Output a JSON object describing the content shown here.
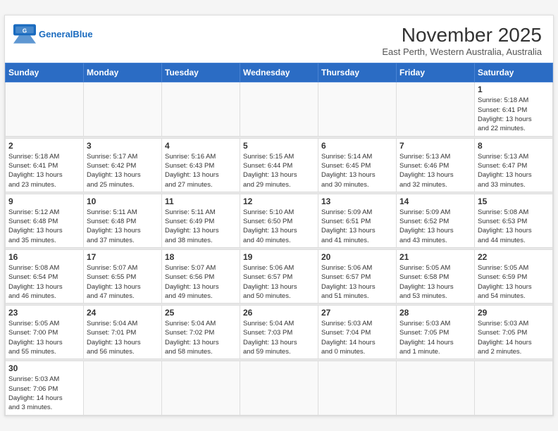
{
  "header": {
    "logo_general": "General",
    "logo_blue": "Blue",
    "month_title": "November 2025",
    "subtitle": "East Perth, Western Australia, Australia"
  },
  "days_of_week": [
    "Sunday",
    "Monday",
    "Tuesday",
    "Wednesday",
    "Thursday",
    "Friday",
    "Saturday"
  ],
  "weeks": [
    [
      {
        "day": "",
        "info": ""
      },
      {
        "day": "",
        "info": ""
      },
      {
        "day": "",
        "info": ""
      },
      {
        "day": "",
        "info": ""
      },
      {
        "day": "",
        "info": ""
      },
      {
        "day": "",
        "info": ""
      },
      {
        "day": "1",
        "info": "Sunrise: 5:18 AM\nSunset: 6:41 PM\nDaylight: 13 hours\nand 22 minutes."
      }
    ],
    [
      {
        "day": "2",
        "info": "Sunrise: 5:18 AM\nSunset: 6:41 PM\nDaylight: 13 hours\nand 23 minutes."
      },
      {
        "day": "3",
        "info": "Sunrise: 5:17 AM\nSunset: 6:42 PM\nDaylight: 13 hours\nand 25 minutes."
      },
      {
        "day": "4",
        "info": "Sunrise: 5:16 AM\nSunset: 6:43 PM\nDaylight: 13 hours\nand 27 minutes."
      },
      {
        "day": "5",
        "info": "Sunrise: 5:15 AM\nSunset: 6:44 PM\nDaylight: 13 hours\nand 29 minutes."
      },
      {
        "day": "6",
        "info": "Sunrise: 5:14 AM\nSunset: 6:45 PM\nDaylight: 13 hours\nand 30 minutes."
      },
      {
        "day": "7",
        "info": "Sunrise: 5:13 AM\nSunset: 6:46 PM\nDaylight: 13 hours\nand 32 minutes."
      },
      {
        "day": "8",
        "info": "Sunrise: 5:13 AM\nSunset: 6:47 PM\nDaylight: 13 hours\nand 33 minutes."
      }
    ],
    [
      {
        "day": "9",
        "info": "Sunrise: 5:12 AM\nSunset: 6:48 PM\nDaylight: 13 hours\nand 35 minutes."
      },
      {
        "day": "10",
        "info": "Sunrise: 5:11 AM\nSunset: 6:48 PM\nDaylight: 13 hours\nand 37 minutes."
      },
      {
        "day": "11",
        "info": "Sunrise: 5:11 AM\nSunset: 6:49 PM\nDaylight: 13 hours\nand 38 minutes."
      },
      {
        "day": "12",
        "info": "Sunrise: 5:10 AM\nSunset: 6:50 PM\nDaylight: 13 hours\nand 40 minutes."
      },
      {
        "day": "13",
        "info": "Sunrise: 5:09 AM\nSunset: 6:51 PM\nDaylight: 13 hours\nand 41 minutes."
      },
      {
        "day": "14",
        "info": "Sunrise: 5:09 AM\nSunset: 6:52 PM\nDaylight: 13 hours\nand 43 minutes."
      },
      {
        "day": "15",
        "info": "Sunrise: 5:08 AM\nSunset: 6:53 PM\nDaylight: 13 hours\nand 44 minutes."
      }
    ],
    [
      {
        "day": "16",
        "info": "Sunrise: 5:08 AM\nSunset: 6:54 PM\nDaylight: 13 hours\nand 46 minutes."
      },
      {
        "day": "17",
        "info": "Sunrise: 5:07 AM\nSunset: 6:55 PM\nDaylight: 13 hours\nand 47 minutes."
      },
      {
        "day": "18",
        "info": "Sunrise: 5:07 AM\nSunset: 6:56 PM\nDaylight: 13 hours\nand 49 minutes."
      },
      {
        "day": "19",
        "info": "Sunrise: 5:06 AM\nSunset: 6:57 PM\nDaylight: 13 hours\nand 50 minutes."
      },
      {
        "day": "20",
        "info": "Sunrise: 5:06 AM\nSunset: 6:57 PM\nDaylight: 13 hours\nand 51 minutes."
      },
      {
        "day": "21",
        "info": "Sunrise: 5:05 AM\nSunset: 6:58 PM\nDaylight: 13 hours\nand 53 minutes."
      },
      {
        "day": "22",
        "info": "Sunrise: 5:05 AM\nSunset: 6:59 PM\nDaylight: 13 hours\nand 54 minutes."
      }
    ],
    [
      {
        "day": "23",
        "info": "Sunrise: 5:05 AM\nSunset: 7:00 PM\nDaylight: 13 hours\nand 55 minutes."
      },
      {
        "day": "24",
        "info": "Sunrise: 5:04 AM\nSunset: 7:01 PM\nDaylight: 13 hours\nand 56 minutes."
      },
      {
        "day": "25",
        "info": "Sunrise: 5:04 AM\nSunset: 7:02 PM\nDaylight: 13 hours\nand 58 minutes."
      },
      {
        "day": "26",
        "info": "Sunrise: 5:04 AM\nSunset: 7:03 PM\nDaylight: 13 hours\nand 59 minutes."
      },
      {
        "day": "27",
        "info": "Sunrise: 5:03 AM\nSunset: 7:04 PM\nDaylight: 14 hours\nand 0 minutes."
      },
      {
        "day": "28",
        "info": "Sunrise: 5:03 AM\nSunset: 7:05 PM\nDaylight: 14 hours\nand 1 minute."
      },
      {
        "day": "29",
        "info": "Sunrise: 5:03 AM\nSunset: 7:05 PM\nDaylight: 14 hours\nand 2 minutes."
      }
    ],
    [
      {
        "day": "30",
        "info": "Sunrise: 5:03 AM\nSunset: 7:06 PM\nDaylight: 14 hours\nand 3 minutes."
      },
      {
        "day": "",
        "info": ""
      },
      {
        "day": "",
        "info": ""
      },
      {
        "day": "",
        "info": ""
      },
      {
        "day": "",
        "info": ""
      },
      {
        "day": "",
        "info": ""
      },
      {
        "day": "",
        "info": ""
      }
    ]
  ]
}
